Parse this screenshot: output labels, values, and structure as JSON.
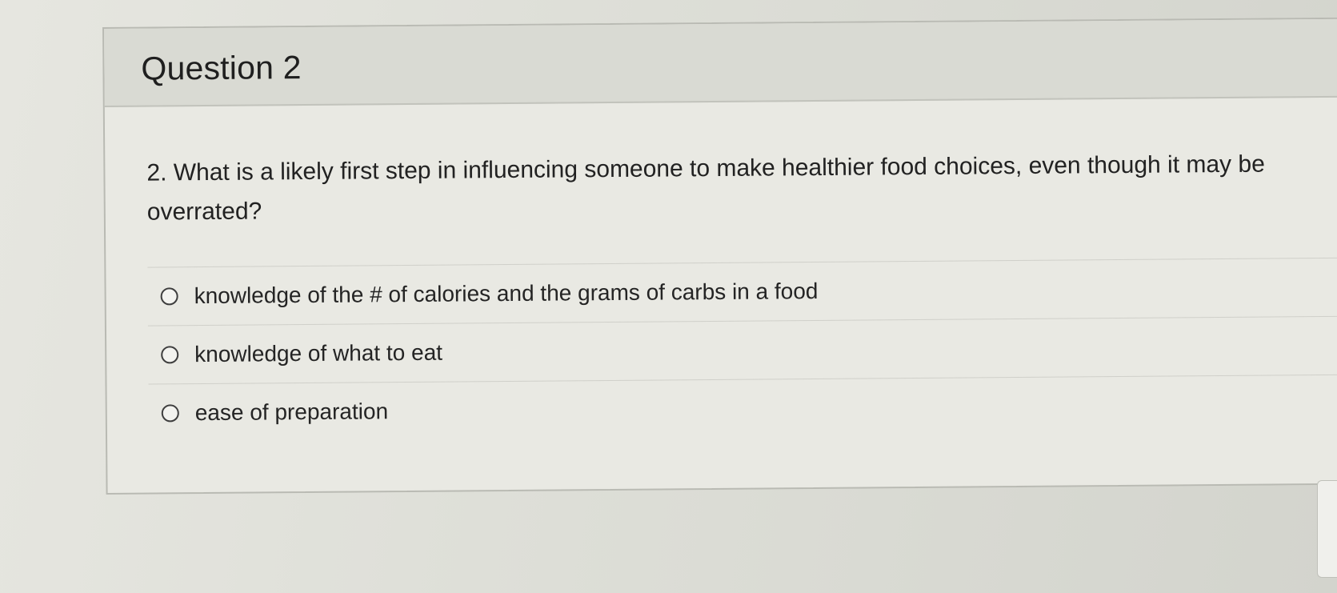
{
  "question": {
    "title": "Question 2",
    "text": "2. What is a likely first step in influencing someone to make healthier food choices, even though it may be overrated?",
    "answers": [
      {
        "label": "knowledge of the # of calories and the grams of carbs in a food"
      },
      {
        "label": "knowledge of what to eat"
      },
      {
        "label": "ease of preparation"
      }
    ]
  },
  "colors": {
    "header_bg": "#d9dad3",
    "card_bg": "#e9e9e3",
    "text": "#222222"
  }
}
